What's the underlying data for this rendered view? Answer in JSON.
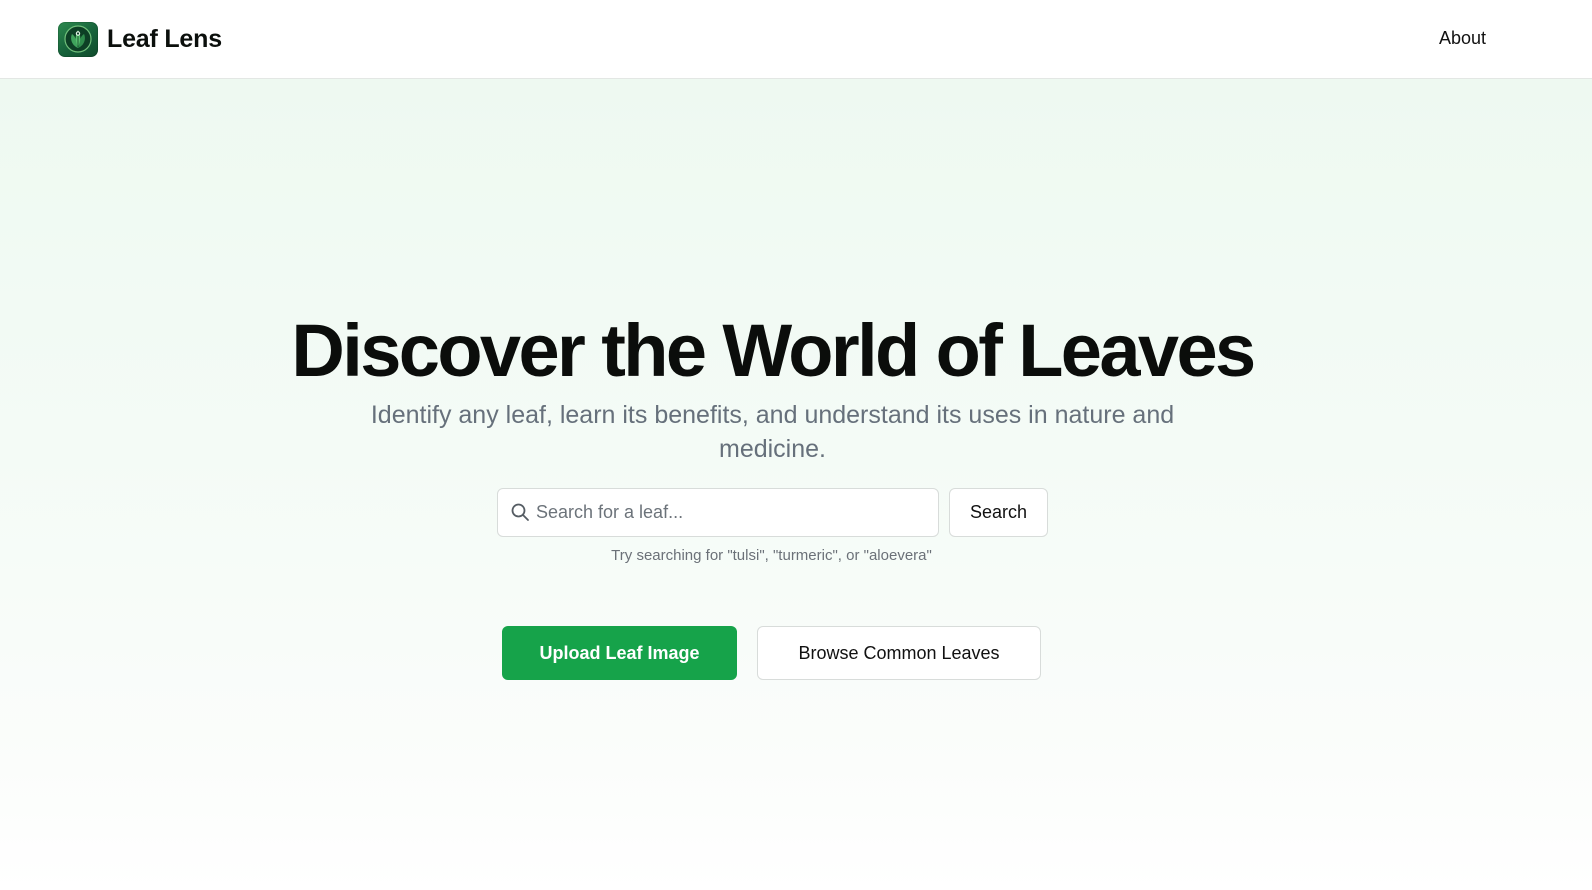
{
  "header": {
    "brand_name": "Leaf Lens",
    "logo_icon": "leaf-logo-icon",
    "nav": {
      "about_label": "About"
    }
  },
  "hero": {
    "title": "Discover the World of Leaves",
    "subtitle": "Identify any leaf, learn its benefits, and understand its uses in nature and medicine."
  },
  "search": {
    "icon": "search-icon",
    "placeholder": "Search for a leaf...",
    "value": "",
    "button_label": "Search",
    "hint": "Try searching for \"tulsi\", \"turmeric\", or \"aloevera\""
  },
  "actions": {
    "upload_label": "Upload Leaf Image",
    "browse_label": "Browse Common Leaves"
  },
  "colors": {
    "accent": "#16a34a",
    "hero_background": "#eef9f1",
    "logo_green": "#16613a",
    "subtitle_gray": "#66707b"
  }
}
